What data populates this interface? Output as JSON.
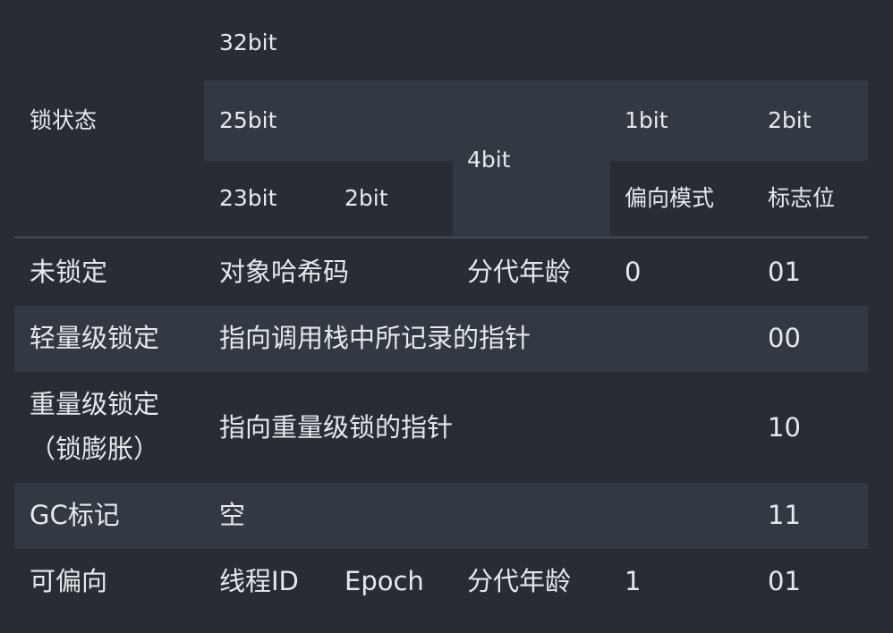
{
  "header": {
    "lock_state": "锁状态",
    "bits_32": "32bit",
    "bits_25": "25bit",
    "bits_4": "4bit",
    "bits_1": "1bit",
    "bits_2a": "2bit",
    "bits_23": "23bit",
    "bits_2b": "2bit",
    "bias_mode": "偏向模式",
    "flag_bit": "标志位"
  },
  "rows": [
    {
      "state": "未锁定",
      "cells": [
        "对象哈希码",
        "分代年龄",
        "0",
        "01"
      ]
    },
    {
      "state": "轻量级锁定",
      "cells": [
        "指向调用栈中所记录的指针",
        "00"
      ]
    },
    {
      "state_line1": "重量级锁定",
      "state_line2": "（锁膨胀）",
      "cells": [
        "指向重量级锁的指针",
        "10"
      ]
    },
    {
      "state": "GC标记",
      "cells": [
        "空",
        "11"
      ]
    },
    {
      "state": "可偏向",
      "cells": [
        "线程ID",
        "Epoch",
        "分代年龄",
        "1",
        "01"
      ]
    }
  ]
}
